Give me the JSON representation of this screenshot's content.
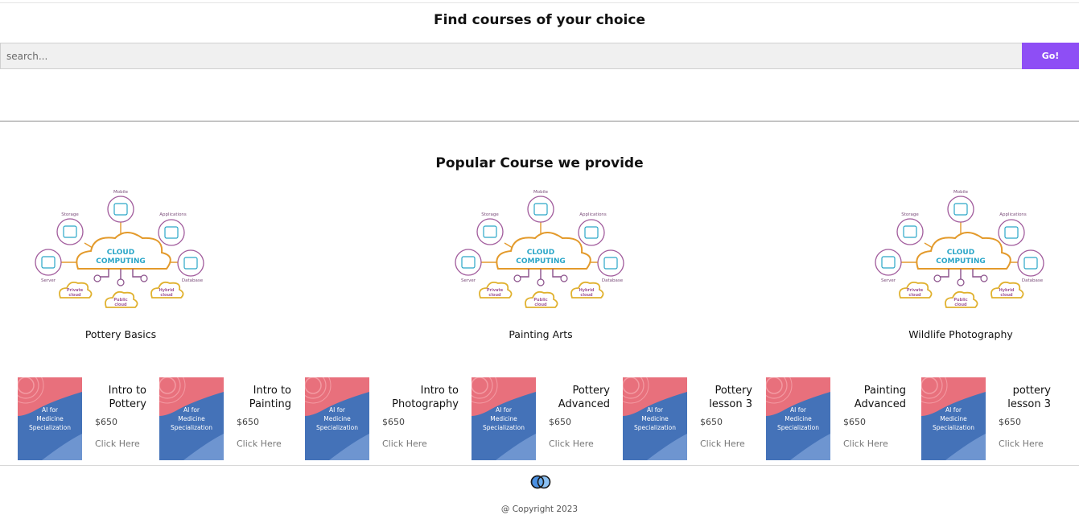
{
  "header": {
    "title": "Find courses of your choice"
  },
  "search": {
    "placeholder": "search...",
    "button_label": "Go!"
  },
  "popular": {
    "title": "Popular Course we provide",
    "image_text": {
      "cloud": "CLOUD",
      "computing": "COMPUTING",
      "mobile": "Mobile",
      "storage": "Storage",
      "applications": "Applications",
      "server": "Server",
      "database": "Database",
      "private": "Private",
      "public": "Public",
      "hybrid": "Hybrid",
      "cloud_word": "cloud"
    },
    "courses": [
      {
        "name": "Pottery Basics"
      },
      {
        "name": "Painting Arts"
      },
      {
        "name": "Wildlife Photography"
      }
    ]
  },
  "course_list": {
    "thumb_text": [
      "AI for",
      "Medicine",
      "Specialization"
    ],
    "colors": {
      "thumb_blue": "#4472b8",
      "thumb_pink": "#e8707c"
    },
    "items": [
      {
        "title": "Intro to Pottery",
        "price": "$650",
        "link": "Click Here"
      },
      {
        "title": "Intro to Painting",
        "price": "$650",
        "link": "Click Here"
      },
      {
        "title": "Intro to Photography",
        "price": "$650",
        "link": "Click Here"
      },
      {
        "title": "Pottery Advanced",
        "price": "$650",
        "link": "Click Here"
      },
      {
        "title": "Pottery lesson 3",
        "price": "$650",
        "link": "Click Here"
      },
      {
        "title": "Painting Advanced",
        "price": "$650",
        "link": "Click Here"
      },
      {
        "title": "pottery lesson 3",
        "price": "$650",
        "link": "Click Here"
      }
    ]
  },
  "footer": {
    "logo_icon": "interlocking-rings-icon",
    "copyright": "@ Copyright 2023"
  },
  "theme": {
    "accent": "#8e4ef5"
  }
}
